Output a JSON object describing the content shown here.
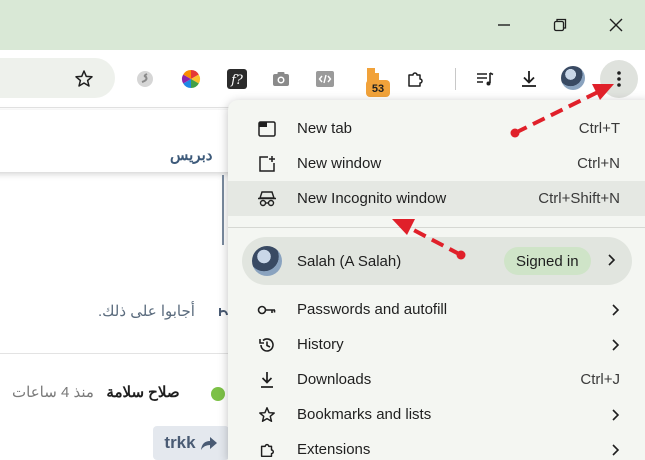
{
  "window": {
    "minimize_icon": "minimize-icon",
    "restore_icon": "restore-icon",
    "close_icon": "close-icon"
  },
  "toolbar": {
    "bookmark_star_icon": "star-icon",
    "extensions": [
      {
        "name": "extension-s-icon"
      },
      {
        "name": "color-wheel-icon"
      },
      {
        "name": "font-question-icon"
      },
      {
        "name": "camera-icon"
      },
      {
        "name": "code-icon"
      },
      {
        "name": "extension-badge-icon"
      }
    ],
    "extension_badge": "53",
    "puzzle_icon": "puzzle-icon",
    "media_icon": "media-queue-icon",
    "download_icon": "download-icon",
    "menu_icon": "three-dot-menu-icon"
  },
  "page": {
    "header_text": "دبريس",
    "question_text": "أجابوا على ذلك.",
    "author_name": "صلاح سلامة",
    "time_ago": "منذ 4 ساعات",
    "reply_label": "trkk"
  },
  "menu": {
    "items_top": [
      {
        "label": "New tab",
        "shortcut": "Ctrl+T",
        "icon": "new-tab-icon"
      },
      {
        "label": "New window",
        "shortcut": "Ctrl+N",
        "icon": "new-window-icon"
      },
      {
        "label": "New Incognito window",
        "shortcut": "Ctrl+Shift+N",
        "icon": "incognito-icon"
      }
    ],
    "profile": {
      "name": "Salah (A Salah)",
      "status": "Signed in"
    },
    "items_bottom": [
      {
        "label": "Passwords and autofill",
        "shortcut": "",
        "icon": "key-icon",
        "submenu": true
      },
      {
        "label": "History",
        "shortcut": "",
        "icon": "history-icon",
        "submenu": true
      },
      {
        "label": "Downloads",
        "shortcut": "Ctrl+J",
        "icon": "download-icon",
        "submenu": false
      },
      {
        "label": "Bookmarks and lists",
        "shortcut": "",
        "icon": "star-icon",
        "submenu": true
      },
      {
        "label": "Extensions",
        "shortcut": "",
        "icon": "puzzle-icon",
        "submenu": true
      }
    ]
  },
  "colors": {
    "titlebar": "#d9e8d6",
    "menu_bg": "#f4f6f2",
    "annotation_arrow": "#e0202a",
    "signed_in_chip": "#cfe4c8"
  }
}
